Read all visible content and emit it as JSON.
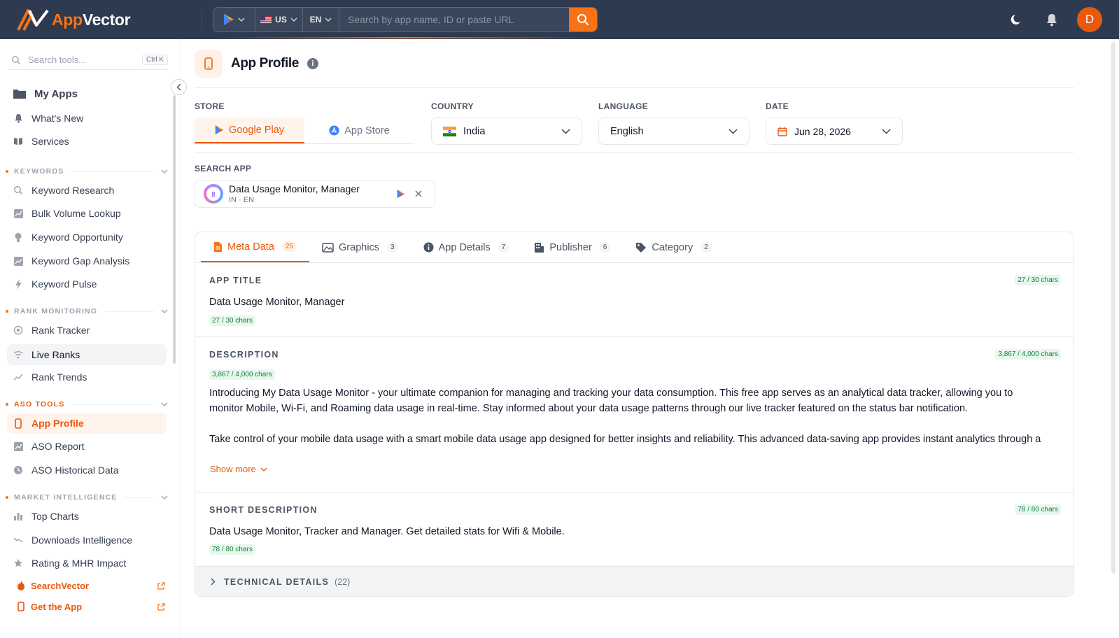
{
  "brand": {
    "name_a": "App",
    "name_b": "Vector"
  },
  "topbar": {
    "country_code": "US",
    "language_code": "EN",
    "search_placeholder": "Search by app name, ID or paste URL",
    "avatar_initial": "D"
  },
  "sidebar": {
    "search_placeholder": "Search tools...",
    "search_shortcut": "Ctrl K",
    "top_items": [
      {
        "label": "My Apps",
        "icon": "folder-icon"
      },
      {
        "label": "What's New",
        "icon": "bell-icon"
      },
      {
        "label": "Services",
        "icon": "book-icon"
      }
    ],
    "sections": [
      {
        "title": "KEYWORDS",
        "items": [
          "Keyword Research",
          "Bulk Volume Lookup",
          "Keyword Opportunity",
          "Keyword Gap Analysis",
          "Keyword Pulse"
        ]
      },
      {
        "title": "RANK MONITORING",
        "items": [
          "Rank Tracker",
          "Live Ranks",
          "Rank Trends"
        ]
      },
      {
        "title": "ASO TOOLS",
        "items": [
          "App Profile",
          "ASO Report",
          "ASO Historical Data"
        ]
      },
      {
        "title": "MARKET INTELLIGENCE",
        "items": [
          "Top Charts",
          "Downloads Intelligence",
          "Rating & MHR Impact"
        ]
      }
    ],
    "footer": [
      "SearchVector",
      "Get the App"
    ]
  },
  "page": {
    "title": "App Profile",
    "labels": {
      "store": "STORE",
      "country": "COUNTRY",
      "language": "LANGUAGE",
      "date": "DATE",
      "search_app": "SEARCH APP"
    },
    "store_tabs": [
      "Google Play",
      "App Store"
    ],
    "country": "India",
    "language": "English",
    "date": "Jun 28, 2026",
    "app": {
      "name": "Data Usage Monitor, Manager",
      "sub": "IN · EN"
    }
  },
  "tabs": [
    {
      "label": "Meta Data",
      "count": "25"
    },
    {
      "label": "Graphics",
      "count": "3"
    },
    {
      "label": "App Details",
      "count": "7"
    },
    {
      "label": "Publisher",
      "count": "6"
    },
    {
      "label": "Category",
      "count": "2"
    }
  ],
  "meta": {
    "app_title": {
      "label": "APP TITLE",
      "value": "Data Usage Monitor, Manager",
      "chars": "27 / 30 chars"
    },
    "description": {
      "label": "DESCRIPTION",
      "chars": "3,867 / 4,000 chars",
      "p1": "Introducing My Data Usage Monitor - your ultimate companion for managing and tracking your data consumption. This free app serves as an analytical data tracker, allowing you to monitor Mobile, Wi-Fi, and Roaming data usage in real-time. Stay informed about your data usage patterns through our live tracker featured on the status bar notification.",
      "p2": "Take control of your mobile data usage with a smart mobile data usage app designed for better insights and reliability. This advanced data-saving app provides instant analytics through a",
      "show_more": "Show more"
    },
    "short_description": {
      "label": "SHORT DESCRIPTION",
      "value": "Data Usage Monitor, Tracker and Manager. Get detailed stats for Wifi & Mobile.",
      "chars": "78 / 80 chars"
    },
    "technical": {
      "label": "TECHNICAL DETAILS",
      "count": "(22)"
    }
  },
  "colors": {
    "accent": "#ea580c",
    "topbar": "#2e3a4f",
    "success": "#15803d"
  }
}
